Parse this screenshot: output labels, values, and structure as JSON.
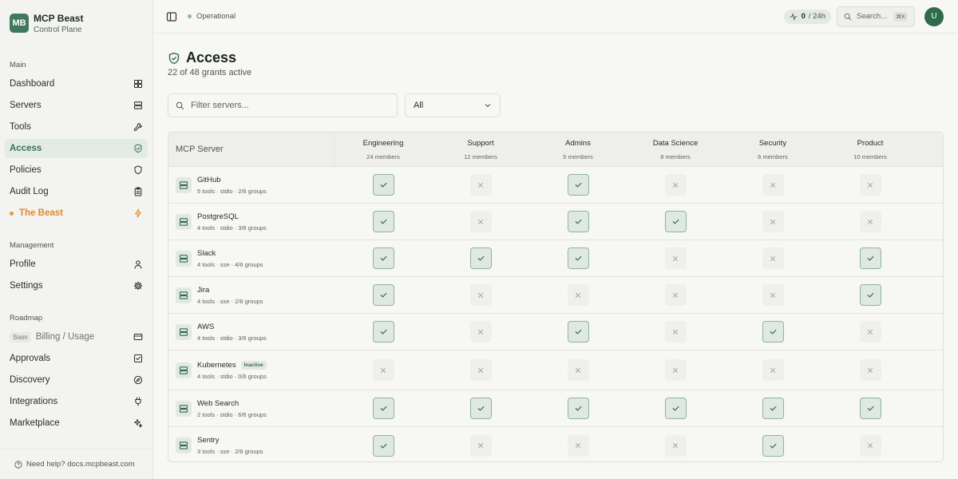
{
  "brand": {
    "logo": "MB",
    "name": "MCP Beast",
    "subtitle": "Control Plane"
  },
  "sidebar": {
    "sections": {
      "main": "Main",
      "management": "Management",
      "roadmap": "Roadmap"
    },
    "main_items": [
      {
        "label": "Dashboard",
        "icon": "dashboard-icon"
      },
      {
        "label": "Servers",
        "icon": "server-icon"
      },
      {
        "label": "Tools",
        "icon": "wrench-icon"
      },
      {
        "label": "Access",
        "icon": "shield-check-icon",
        "active": true
      },
      {
        "label": "Policies",
        "icon": "shield-icon"
      },
      {
        "label": "Audit Log",
        "icon": "clipboard-icon"
      },
      {
        "label": "The Beast",
        "icon": "bolt-icon",
        "accent": true
      }
    ],
    "management_items": [
      {
        "label": "Profile",
        "icon": "user-icon"
      },
      {
        "label": "Settings",
        "icon": "gear-icon"
      }
    ],
    "roadmap_items": [
      {
        "label": "Billing / Usage",
        "badge": "Soon",
        "icon": "card-icon"
      },
      {
        "label": "Approvals",
        "icon": "checkbox-icon"
      },
      {
        "label": "Discovery",
        "icon": "compass-icon"
      },
      {
        "label": "Integrations",
        "icon": "plug-icon"
      },
      {
        "label": "Marketplace",
        "icon": "sparkle-icon"
      }
    ],
    "help": "Need help? docs.mcpbeast.com"
  },
  "topbar": {
    "status": "Operational",
    "activity_count": "0",
    "activity_window": "/ 24h",
    "search_label": "Search...",
    "search_shortcut": "⌘K",
    "avatar": "U"
  },
  "page": {
    "title": "Access",
    "subtitle": "22 of 48 grants active",
    "filter_placeholder": "Filter servers...",
    "filter_select": "All"
  },
  "matrix": {
    "server_header": "MCP Server",
    "groups": [
      {
        "name": "Engineering",
        "members": "24 members"
      },
      {
        "name": "Support",
        "members": "12 members"
      },
      {
        "name": "Admins",
        "members": "5 members"
      },
      {
        "name": "Data Science",
        "members": "8 members"
      },
      {
        "name": "Security",
        "members": "6 members"
      },
      {
        "name": "Product",
        "members": "10 members"
      }
    ],
    "rows": [
      {
        "name": "GitHub",
        "meta": "5 tools · stdio · 2/6 groups",
        "grants": [
          true,
          false,
          true,
          false,
          false,
          false
        ]
      },
      {
        "name": "PostgreSQL",
        "meta": "4 tools · stdio · 3/6 groups",
        "grants": [
          true,
          false,
          true,
          true,
          false,
          false
        ]
      },
      {
        "name": "Slack",
        "meta": "4 tools · sse · 4/6 groups",
        "grants": [
          true,
          true,
          true,
          false,
          false,
          true
        ]
      },
      {
        "name": "Jira",
        "meta": "4 tools · sse · 2/6 groups",
        "grants": [
          true,
          false,
          false,
          false,
          false,
          true
        ]
      },
      {
        "name": "AWS",
        "meta": "4 tools · stdio · 3/6 groups",
        "grants": [
          true,
          false,
          true,
          false,
          true,
          false
        ]
      },
      {
        "name": "Kubernetes",
        "badge": "Inactive",
        "meta": "4 tools · stdio · 0/6 groups",
        "grants": [
          false,
          false,
          false,
          false,
          false,
          false
        ]
      },
      {
        "name": "Web Search",
        "meta": "2 tools · stdio · 6/6 groups",
        "grants": [
          true,
          true,
          true,
          true,
          true,
          true
        ]
      },
      {
        "name": "Sentry",
        "meta": "3 tools · sse · 2/6 groups",
        "grants": [
          true,
          false,
          false,
          false,
          true,
          false
        ]
      }
    ]
  },
  "colors": {
    "accent": "#3f7a5a",
    "beast": "#e08a2a",
    "grant_on_bg": "#dfe9e2",
    "grant_on_border": "#8fb49b"
  }
}
